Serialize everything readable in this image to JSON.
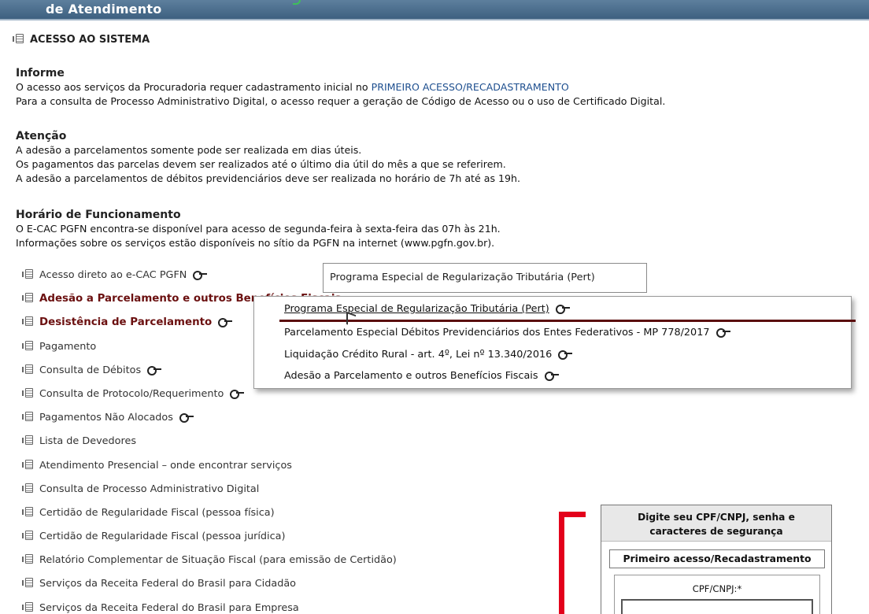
{
  "header": {
    "title": "de Atendimento"
  },
  "section": {
    "title": "ACESSO AO SISTEMA"
  },
  "informe": {
    "heading": "Informe",
    "line1_prefix": "O acesso aos serviços da Procuradoria requer cadastramento inicial no ",
    "line1_link": "PRIMEIRO ACESSO/RECADASTRAMENTO",
    "line2": "Para a consulta de Processo Administrativo Digital, o acesso requer a geração de Código de Acesso ou o uso de Certificado Digital."
  },
  "atencao": {
    "heading": "Atenção",
    "line1": "A adesão a parcelamentos somente pode ser realizada em dias úteis.",
    "line2": "Os pagamentos das parcelas devem ser realizados até o último dia útil do mês a que se referirem.",
    "line3": "A adesão a parcelamentos de débitos previdenciários deve ser realizada no horário de 7h até as 19h."
  },
  "horario": {
    "heading": "Horário de Funcionamento",
    "line1": "O E-CAC PGFN encontra-se disponível para acesso de segunda-feira à sexta-feira das 07h às 21h.",
    "line2": "Informações sobre os serviços estão disponíveis no sítio da PGFN na internet (www.pgfn.gov.br)."
  },
  "menu": {
    "items": [
      {
        "label": "Acesso direto ao e-CAC PGFN"
      },
      {
        "label": "Adesão a Parcelamento e outros Benefícios Fiscais"
      },
      {
        "label": "Desistência de Parcelamento"
      },
      {
        "label": "Pagamento"
      },
      {
        "label": "Consulta de Débitos"
      },
      {
        "label": "Consulta de Protocolo/Requerimento"
      },
      {
        "label": "Pagamentos Não Alocados"
      },
      {
        "label": "Lista de Devedores"
      },
      {
        "label": "Atendimento Presencial – onde encontrar serviços"
      },
      {
        "label": "Consulta de Processo Administrativo Digital"
      },
      {
        "label": "Certidão de Regularidade Fiscal (pessoa física)"
      },
      {
        "label": "Certidão de Regularidade Fiscal (pessoa jurídica)"
      },
      {
        "label": "Relatório Complementar de Situação Fiscal (para emissão de Certidão)"
      },
      {
        "label": "Serviços da Receita Federal do Brasil para Cidadão"
      },
      {
        "label": "Serviços da Receita Federal do Brasil para Empresa"
      }
    ]
  },
  "tooltip": {
    "text": "Programa Especial de Regularização Tributária (Pert)"
  },
  "submenu": {
    "options": [
      {
        "label": "Programa Especial de Regularização Tributária (Pert)"
      },
      {
        "label": "Parcelamento Especial Débitos Previdenciários dos Entes Federativos - MP 778/2017"
      },
      {
        "label": "Liquidação Crédito Rural - art. 4º, Lei nº 13.340/2016"
      },
      {
        "label": "Adesão a Parcelamento e outros Benefícios Fiscais"
      }
    ]
  },
  "login": {
    "header_line1": "Digite seu CPF/CNPJ, senha e",
    "header_line2": "caracteres de segurança",
    "first_access": "Primeiro acesso/Recadastramento",
    "cpf_label": "CPF/CNPJ:*"
  },
  "colors": {
    "header_bar": "#4a6d8c",
    "bold_menu": "#6b1010",
    "link": "#1e4f8f",
    "highlight_red": "#e3001b"
  },
  "icons": {
    "menu_item": "page-icon",
    "restricted": "key-icon"
  }
}
